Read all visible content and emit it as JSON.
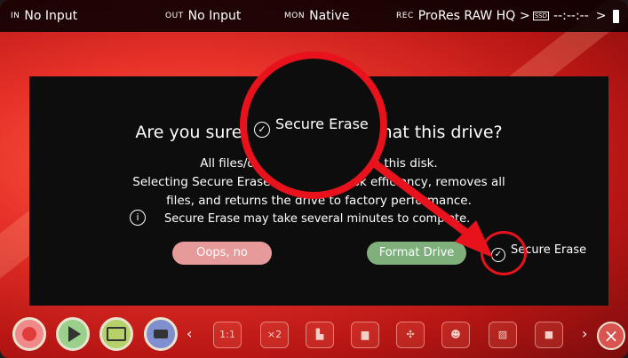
{
  "status": {
    "in_key": "IN",
    "in_value": "No Input",
    "out_key": "OUT",
    "out_value": "No Input",
    "mon_key": "MON",
    "mon_value": "Native",
    "rec_key": "REC",
    "rec_value": "ProRes RAW HQ",
    "ssd_label": "SSD",
    "timecode": "--:--:--",
    "colors": {
      "bar": "#000000"
    }
  },
  "dialog": {
    "title": "Are you sure you want to format this drive?",
    "body_line1": "All files/data will be erased on this disk.",
    "body_line2": "Selecting Secure Erase maximizes disk efficiency, removes all",
    "body_line3": "files, and returns the drive to factory performance.",
    "note": "Secure Erase may take several minutes to complete.",
    "cancel_label": "Oops, no",
    "confirm_label": "Format Drive",
    "secure_label": "Secure Erase",
    "secure_checked": true
  },
  "zoom": {
    "label": "Secure Erase",
    "color": "#e8121c"
  },
  "toolbar": {
    "buttons": [
      "record",
      "play",
      "monitor",
      "tags"
    ],
    "tools": [
      "1:1",
      "x2",
      "waveform",
      "histogram",
      "vectorscope",
      "false-color",
      "zebra",
      "frame"
    ],
    "tool_icons": [
      "zoom-1to1-icon",
      "zoom-x2-icon",
      "waveform-icon",
      "histogram-icon",
      "vectorscope-icon",
      "false-color-icon",
      "zebra-icon",
      "frame-guide-icon"
    ]
  }
}
